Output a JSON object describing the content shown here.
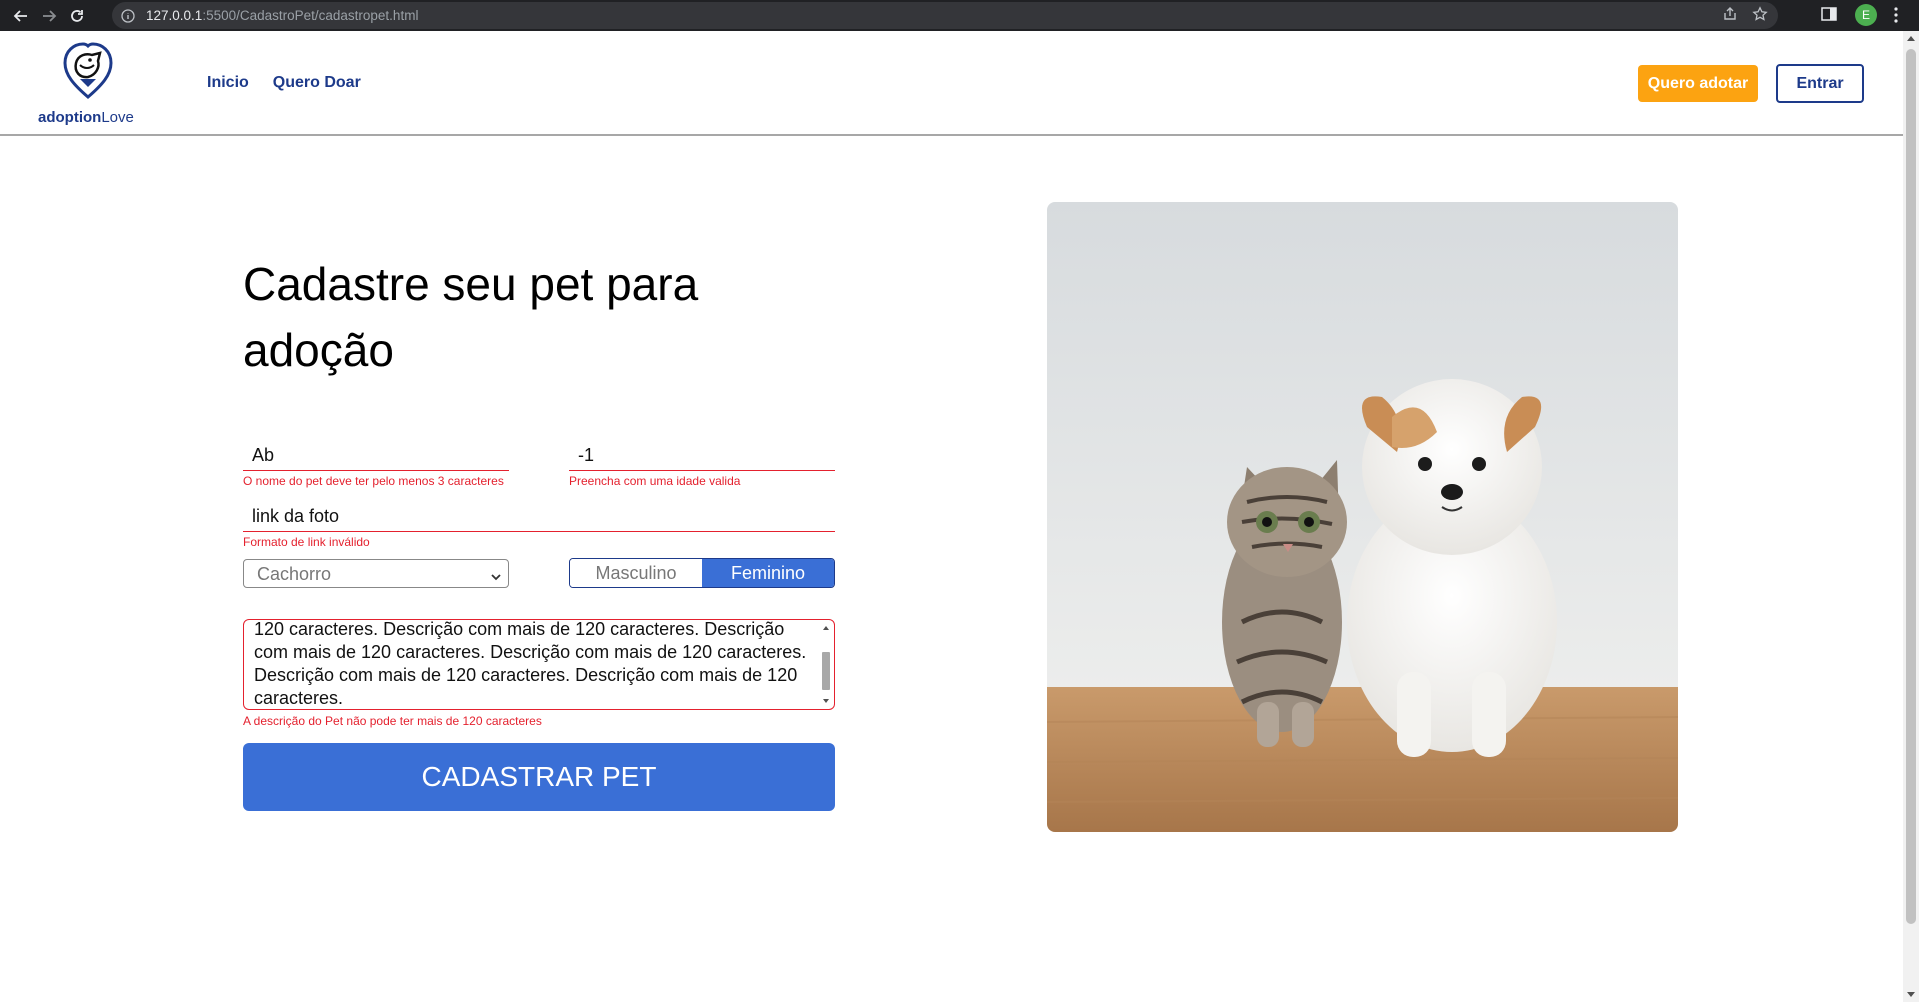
{
  "browser": {
    "url_host": "127.0.0.1",
    "url_rest": ":5500/CadastroPet/cadastropet.html",
    "profile_initial": "E"
  },
  "header": {
    "brand_bold": "adoption",
    "brand_lite": "Love",
    "nav": [
      "Inicio",
      "Quero Doar"
    ],
    "adopt_button": "Quero adotar",
    "login_button": "Entrar"
  },
  "form": {
    "title": "Cadastre seu pet para adoção",
    "name_value": "Ab",
    "name_error": "O nome do pet deve ter pelo menos 3 caracteres",
    "age_value": "-1",
    "age_error": "Preencha com uma idade valida",
    "photo_value": "link da foto",
    "photo_error": "Formato de link inválido",
    "species_selected": "Cachorro",
    "gender_options": [
      "Masculino",
      "Feminino"
    ],
    "gender_selected": "Feminino",
    "description_value": "120 caracteres. Descrição com mais de 120 caracteres. Descrição com mais de 120 caracteres. Descrição com mais de 120 caracteres. Descrição com mais de 120 caracteres. Descrição com mais de 120 caracteres.",
    "description_error": "A descrição do Pet não pode ter mais de 120 caracteres",
    "submit_label": "CADASTRAR PET"
  },
  "colors": {
    "brand_blue": "#1d3a8a",
    "accent_orange": "#fca311",
    "primary_button": "#3a6fd6",
    "error_red": "#e4212e"
  },
  "icons": [
    "back-arrow-icon",
    "forward-arrow-icon",
    "reload-icon",
    "info-icon",
    "share-icon",
    "star-icon",
    "side-panel-icon",
    "menu-kebab-icon",
    "pet-heart-logo-icon",
    "chevron-down-icon"
  ]
}
